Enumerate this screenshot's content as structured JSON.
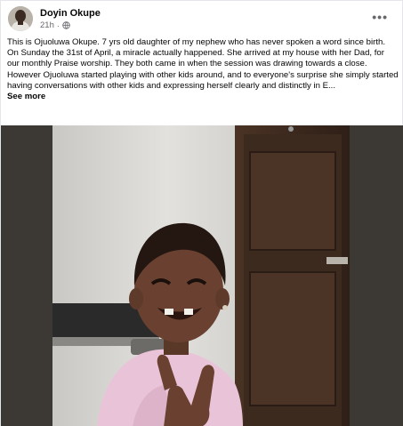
{
  "post": {
    "author": "Doyin Okupe",
    "time": "21h",
    "visibility_icon": "globe-icon",
    "menu_icon": "more-options-icon",
    "paragraph1": "This is Ojuoluwa Okupe. 7 yrs old daughter of my nephew who has never spoken a word since birth. On Sunday the 31st of April, a miracle actually happened. She arrived at my house with her Dad, for our monthly Praise worship. They both came in when the session was drawing towards a close.",
    "paragraph2": "However Ojuoluwa started playing with other kids around, and to everyone's surprise she simply started having conversations with other kids and expressing herself clearly and distinctly in E...",
    "see_more": "See more"
  },
  "colors": {
    "text": "#050505",
    "secondary": "#65676b",
    "media_bg": "#3c3834"
  }
}
